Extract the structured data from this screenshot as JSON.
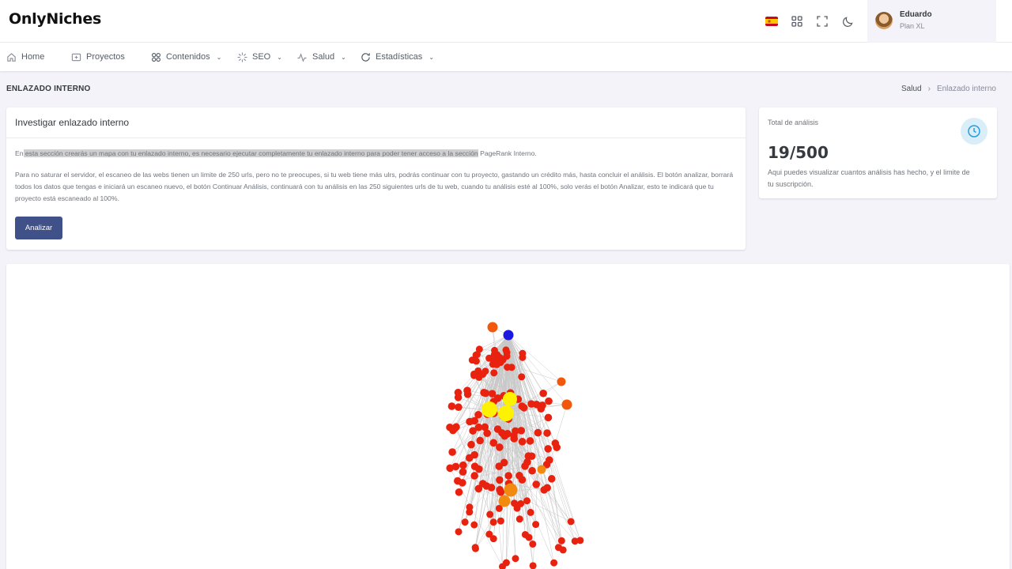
{
  "app": {
    "logo": "OnlyNiches"
  },
  "header": {
    "icons": [
      "spain-flag-icon",
      "apps-grid-icon",
      "fullscreen-icon",
      "moon-icon"
    ],
    "user": {
      "name": "Eduardo",
      "plan": "Plan XL"
    }
  },
  "nav": {
    "items": [
      {
        "label": "Home",
        "icon": "home-icon",
        "dropdown": false
      },
      {
        "label": "Proyectos",
        "icon": "folder-icon",
        "dropdown": false
      },
      {
        "label": "Contenidos",
        "icon": "grid-icon",
        "dropdown": true
      },
      {
        "label": "SEO",
        "icon": "loader-icon",
        "dropdown": true
      },
      {
        "label": "Salud",
        "icon": "pulse-icon",
        "dropdown": true
      },
      {
        "label": "Estadísticas",
        "icon": "refresh-icon",
        "dropdown": true
      }
    ]
  },
  "page": {
    "title": "ENLAZADO INTERNO",
    "breadcrumb": [
      "Salud",
      "Enlazado interno"
    ]
  },
  "main_card": {
    "title": "Investigar enlazado interno",
    "p1_a": "En",
    "p1_highlight": " esta sección crearás un mapa con tu enlazado interno, es necesario ejecutar completamente tu enlazado interno para poder tener acceso a la sección",
    "p1_b": " PageRank Interno.",
    "p2": "Para no saturar el servidor, el escaneo de las webs tienen un limite de 250 urls, pero no te preocupes, si tu web tiene más ulrs, podrás continuar con tu proyecto, gastando un crédito más, hasta concluir el análisis. El botón analizar, borrará todos los datos que tengas e iniciará un escaneo nuevo, el botón Continuar Análisis, continuará con tu análisis en las 250 siguientes urls de tu web, cuando tu análisis esté al 100%, solo verás el botón Analizar, esto te indicará que tu proyecto está escaneado al 100%.",
    "button": "Analizar"
  },
  "stats_card": {
    "label": "Total de análisis",
    "value": "19/500",
    "description": "Aqui puedes visualizar cuantos análisis has hecho, y el limite de tu suscripción.",
    "icon": "clock-icon"
  },
  "graph": {
    "colors": {
      "page": "#e8220f",
      "hub": "#fff200",
      "secondary": "#f28a10",
      "root": "#1a18e0",
      "accent": "#f2580c",
      "edge": "#c8c8c8"
    },
    "special_nodes": {
      "root": 1,
      "hubs": 3,
      "secondary": 4
    }
  }
}
